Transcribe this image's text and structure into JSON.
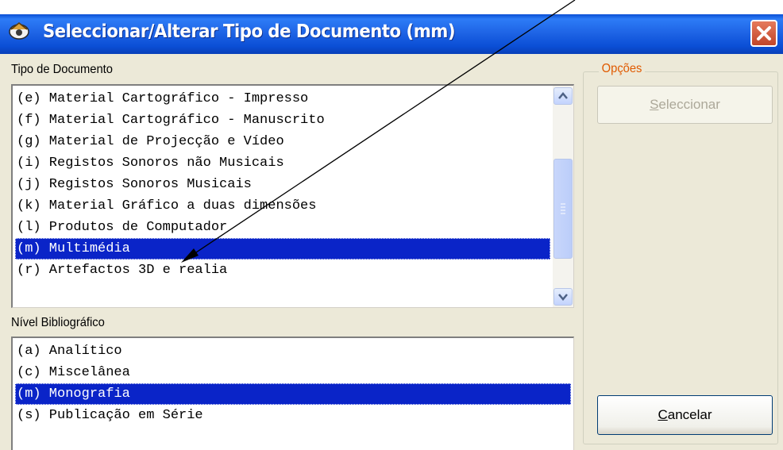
{
  "window": {
    "title": "Seleccionar/Alterar Tipo de Documento (mm)"
  },
  "doc_type": {
    "label": "Tipo de Documento",
    "items": [
      "(e) Material Cartográfico - Impresso",
      "(f) Material Cartográfico - Manuscrito",
      "(g) Material de Projecção e Vídeo",
      "(i) Registos Sonoros não Musicais",
      "(j) Registos Sonoros Musicais",
      "(k) Material Gráfico a duas dimensões",
      "(l) Produtos de Computador",
      "(m) Multimédia",
      "(r) Artefactos 3D e realia"
    ],
    "selected": "(m) Multimédia"
  },
  "bib_level": {
    "label": "Nível Bibliográfico",
    "items": [
      "(a) Analítico",
      "(c) Miscelânea",
      "(m) Monografia",
      "(s) Publicação em Série"
    ],
    "selected": "(m) Monografia"
  },
  "options": {
    "label": "Opções",
    "select_button": {
      "accel": "S",
      "rest": "eleccionar",
      "enabled": false
    },
    "cancel_button": {
      "accel": "C",
      "rest": "ancelar",
      "enabled": true
    }
  },
  "colors": {
    "titlebar": "#0a4fd4",
    "selection": "#0a24c8",
    "group_label_orange": "#e05a00",
    "dialog_bg": "#ece9d8"
  },
  "icons": {
    "app": "app-icon",
    "close": "close-icon",
    "scroll_up": "chevron-up-icon",
    "scroll_down": "chevron-down-icon"
  }
}
